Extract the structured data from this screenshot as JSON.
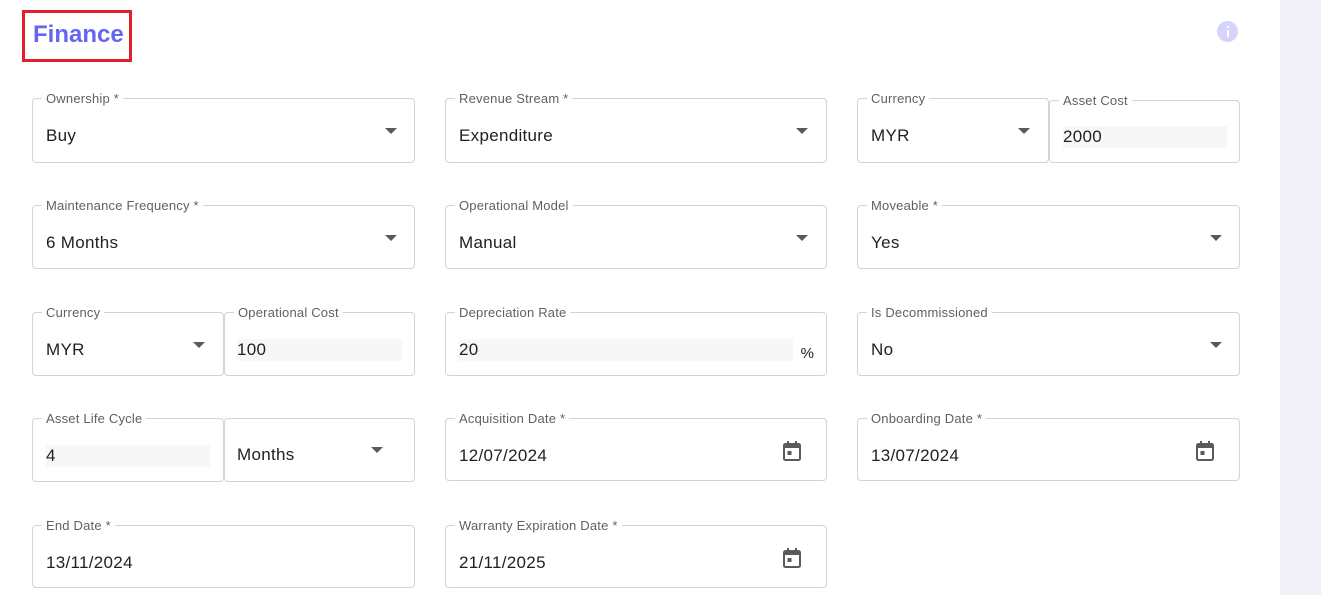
{
  "section": {
    "title": "Finance"
  },
  "icons": {
    "info": "info-icon",
    "dropdown": "chevron-down-icon",
    "calendar": "calendar-icon"
  },
  "colors": {
    "title": "#6466f1",
    "highlight_box": "#e0202a",
    "info_icon": "#d6d4fb"
  },
  "fields": {
    "ownership": {
      "label": "Ownership *",
      "value": "Buy"
    },
    "revenue_stream": {
      "label": "Revenue Stream *",
      "value": "Expenditure"
    },
    "currency_asset": {
      "label": "Currency",
      "value": "MYR"
    },
    "asset_cost": {
      "label": "Asset Cost",
      "value": "2000"
    },
    "maintenance_frequency": {
      "label": "Maintenance Frequency *",
      "value": "6 Months"
    },
    "operational_model": {
      "label": "Operational Model",
      "value": "Manual"
    },
    "moveable": {
      "label": "Moveable *",
      "value": "Yes"
    },
    "currency_operational": {
      "label": "Currency",
      "value": "MYR"
    },
    "operational_cost": {
      "label": "Operational Cost",
      "value": "100"
    },
    "depreciation_rate": {
      "label": "Depreciation Rate",
      "value": "20",
      "suffix": "%"
    },
    "is_decommissioned": {
      "label": "Is Decommissioned",
      "value": "No"
    },
    "asset_life_cycle": {
      "label": "Asset Life Cycle",
      "value": "4"
    },
    "life_cycle_unit": {
      "value": "Months"
    },
    "acquisition_date": {
      "label": "Acquisition Date *",
      "value": "12/07/2024"
    },
    "onboarding_date": {
      "label": "Onboarding Date *",
      "value": "13/07/2024"
    },
    "end_date": {
      "label": "End Date *",
      "value": "13/11/2024"
    },
    "warranty_expiration_date": {
      "label": "Warranty Expiration Date *",
      "value": "21/11/2025"
    }
  }
}
